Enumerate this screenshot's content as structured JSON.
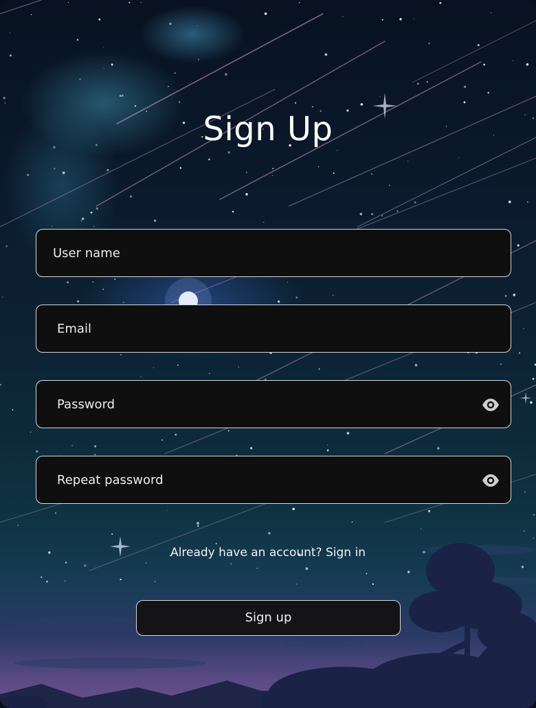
{
  "form": {
    "title": "Sign Up",
    "username": {
      "placeholder": "User name",
      "value": ""
    },
    "email": {
      "placeholder": "Email",
      "value": ""
    },
    "password": {
      "placeholder": "Password",
      "value": "",
      "icon": "eye-icon"
    },
    "repeat_password": {
      "placeholder": "Repeat password",
      "value": "",
      "icon": "eye-icon"
    },
    "signin_prompt": "Already have an account?",
    "signin_link": "Sign in",
    "submit_label": "Sign up"
  },
  "colors": {
    "field_bg": "#0f0f10",
    "field_border": "#d8d8d8",
    "text": "#f2f2f2",
    "icon": "#cfcfcf"
  }
}
